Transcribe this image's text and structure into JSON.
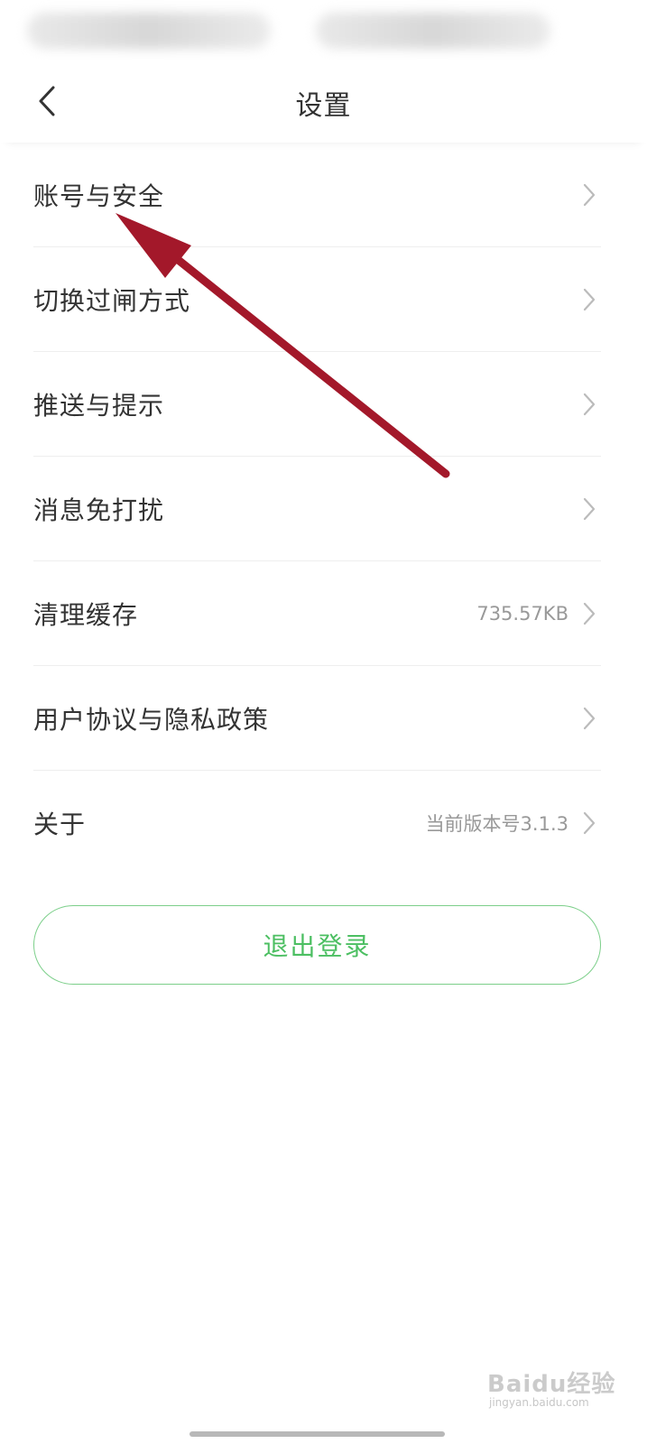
{
  "header": {
    "title": "设置",
    "back_icon": "chevron-left-icon"
  },
  "settings": {
    "items": [
      {
        "label": "账号与安全",
        "value": ""
      },
      {
        "label": "切换过闸方式",
        "value": ""
      },
      {
        "label": "推送与提示",
        "value": ""
      },
      {
        "label": "消息免打扰",
        "value": ""
      },
      {
        "label": "清理缓存",
        "value": "735.57KB"
      },
      {
        "label": "用户协议与隐私政策",
        "value": ""
      },
      {
        "label": "关于",
        "value": "当前版本号3.1.3"
      }
    ],
    "chevron_icon": "chevron-right-icon"
  },
  "logout": {
    "label": "退出登录"
  },
  "watermark": {
    "text": "Baidu经验",
    "sub": "jingyan.baidu.com"
  },
  "colors": {
    "accent_green": "#4cbf62",
    "annotation_arrow": "#a3182a",
    "text_primary": "#333333",
    "text_secondary": "#999999"
  }
}
